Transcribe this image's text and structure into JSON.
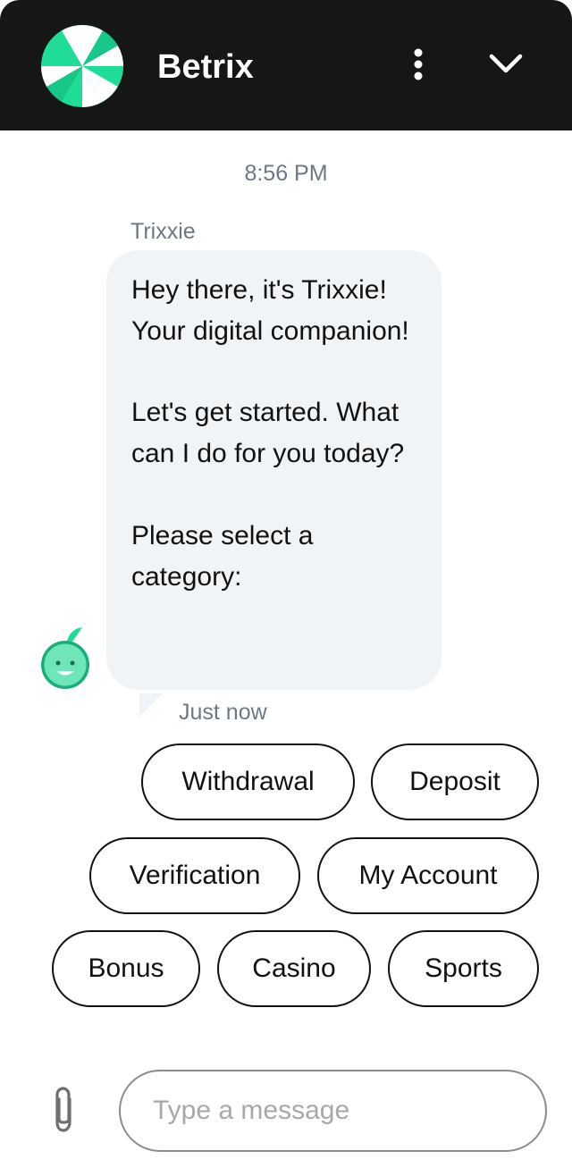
{
  "header": {
    "title": "Betrix",
    "logo_icon": "betrix-wheel-logo-icon",
    "menu_icon": "more-vertical-icon",
    "collapse_icon": "chevron-down-icon",
    "background_color": "#161616",
    "accent_colors": [
      "#1fdc97",
      "#ffffff"
    ]
  },
  "conversation": {
    "timestamp": "8:56 PM",
    "sender": "Trixxie",
    "avatar_icon": "trixxie-bot-avatar-icon",
    "message_paragraphs": [
      "Hey there, it's Trixxie! Your digital companion!",
      "Let's get started. What can I do for you today?",
      "Please select a category:"
    ],
    "message_time": "Just now"
  },
  "quick_replies": [
    "Withdrawal",
    "Deposit",
    "Verification",
    "My Account",
    "Bonus",
    "Casino",
    "Sports"
  ],
  "composer": {
    "placeholder": "Type a message",
    "attach_icon": "paperclip-icon"
  }
}
